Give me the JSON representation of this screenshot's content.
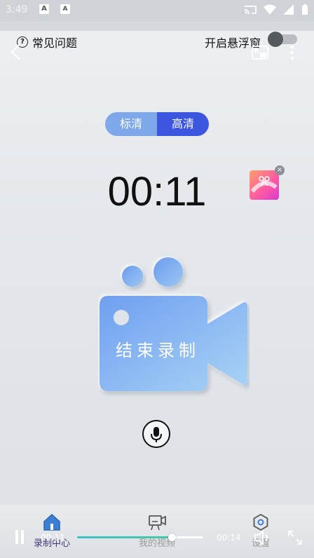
{
  "status_bar": {
    "time": "3:49"
  },
  "header": {
    "faq_label": "常见问题",
    "floating_window_label": "开启悬浮窗",
    "floating_window_on": false
  },
  "quality": {
    "options": [
      "标清",
      "高清"
    ],
    "selected": "高清"
  },
  "timer": "00:11",
  "record_button": {
    "label": "结束录制"
  },
  "tabs": [
    {
      "label": "录制中心",
      "icon": "home-icon",
      "active": true
    },
    {
      "label": "我的视频",
      "icon": "video-icon",
      "active": false
    },
    {
      "label": "设置",
      "icon": "settings-icon",
      "active": false
    }
  ],
  "player": {
    "current_time": "00:11",
    "duration": "00:14",
    "progress": 0.75
  },
  "colors": {
    "accent": "#3c56e0",
    "quality_inactive": "#7fa8ea",
    "camera_blue": "#78a8ee",
    "progress_fill": "#3fc0c8"
  }
}
